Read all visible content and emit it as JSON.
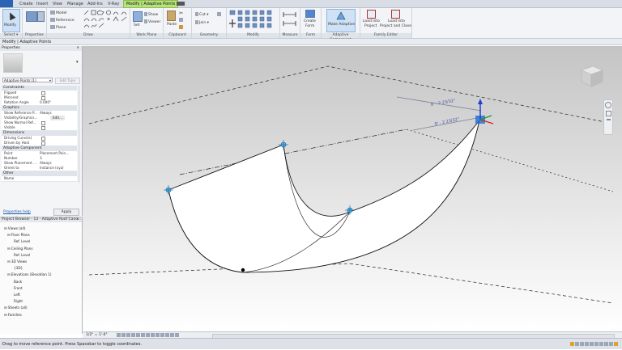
{
  "menu": {
    "tabs": [
      "Create",
      "Insert",
      "View",
      "Manage",
      "Add-Ins",
      "V-Ray",
      "Modify | Adaptive Points"
    ],
    "active_tab": "Modify | Adaptive Points"
  },
  "ribbon": {
    "select_panel": {
      "modify_label": "Modify",
      "panel_label": "Select ▾"
    },
    "properties_panel": {
      "panel_label": "Properties"
    },
    "draw_panel": {
      "model_label": "Model",
      "reference_label": "Reference",
      "plane_label": "Plane",
      "panel_label": "Draw"
    },
    "workplane_panel": {
      "set_label": "Set",
      "show_label": "Show",
      "viewer_label": "Viewer",
      "panel_label": "Work Plane"
    },
    "clipboard_panel": {
      "paste_label": "Paste",
      "panel_label": "Clipboard"
    },
    "geometry_panel": {
      "cut_label": "Cut",
      "join_label": "Join",
      "panel_label": "Geometry"
    },
    "modify_panel": {
      "panel_label": "Modify"
    },
    "measure_panel": {
      "panel_label": "Measure"
    },
    "form_panel": {
      "create_label": "Create",
      "form_label": "Form",
      "panel_label": "Form"
    },
    "adaptive_panel": {
      "make_label": "Make Adaptive",
      "panel_label": "Adaptive Component"
    },
    "family_editor_panel": {
      "load_project_label1": "Load into",
      "load_project_label2": "Project",
      "load_close_label1": "Load into",
      "load_close_label2": "Project and Close",
      "panel_label": "Family Editor"
    }
  },
  "context_bar": {
    "text": "Modify | Adaptive Points"
  },
  "properties": {
    "title": "Properties",
    "type_selector": "Adaptive Points (1)",
    "edit_type": "Edit Type",
    "sections": {
      "constraints": "Constraints",
      "graphics": "Graphics",
      "dimensions": "Dimensions",
      "adaptive": "Adaptive Component",
      "other": "Other"
    },
    "rows": {
      "flipped": "Flipped",
      "mirrored": "Mirrored",
      "rotation_angle": "Rotation Angle",
      "rotation_value": "0.000°",
      "show_ref": "Show Reference P...",
      "show_ref_value": "Always",
      "vis_graphics": "Visibility/Graphics...",
      "vis_graphics_value": "Edit...",
      "show_normal": "Show Normal Ref...",
      "visible": "Visible",
      "driving_curves": "Driving Curve(s)",
      "driven_by_host": "Driven by Host",
      "point": "Point",
      "point_value": "Placement Poin...",
      "number": "Number",
      "number_value": "3",
      "show_placement": "Show Placement ...",
      "show_placement_value": "Always",
      "orient_to": "Orient to",
      "orient_to_value": "Instance (xyz)",
      "name": "Name"
    },
    "help_link": "Properties help",
    "apply_button": "Apply"
  },
  "browser": {
    "title": "Project Browser - 13 - Adaptive Roof Cano...",
    "items": [
      {
        "label": "Views (all)",
        "indent": 0
      },
      {
        "label": "Floor Plans",
        "indent": 1
      },
      {
        "label": "Ref. Level",
        "indent": 3
      },
      {
        "label": "Ceiling Plans",
        "indent": 1
      },
      {
        "label": "Ref. Level",
        "indent": 3
      },
      {
        "label": "3D Views",
        "indent": 1
      },
      {
        "label": "{3D}",
        "indent": 3
      },
      {
        "label": "Elevations (Elevation 1)",
        "indent": 1
      },
      {
        "label": "Back",
        "indent": 3
      },
      {
        "label": "Front",
        "indent": 3
      },
      {
        "label": "Left",
        "indent": 3
      },
      {
        "label": "Right",
        "indent": 3
      },
      {
        "label": "Sheets (all)",
        "indent": 0
      },
      {
        "label": "Families",
        "indent": 0
      }
    ]
  },
  "viewport": {
    "scale": "1/2\" = 1'-0\"",
    "dimension_1": "9' - 2 23/32\"",
    "dimension_2": "9' - 2 23/32\""
  },
  "status": {
    "text": "Drag to move reference point. Press Spacebar to toggle coordinates."
  },
  "colors": {
    "accent": "#b6e37a",
    "ribbon": "#f2f4f7",
    "selection": "#1e6fd9"
  }
}
